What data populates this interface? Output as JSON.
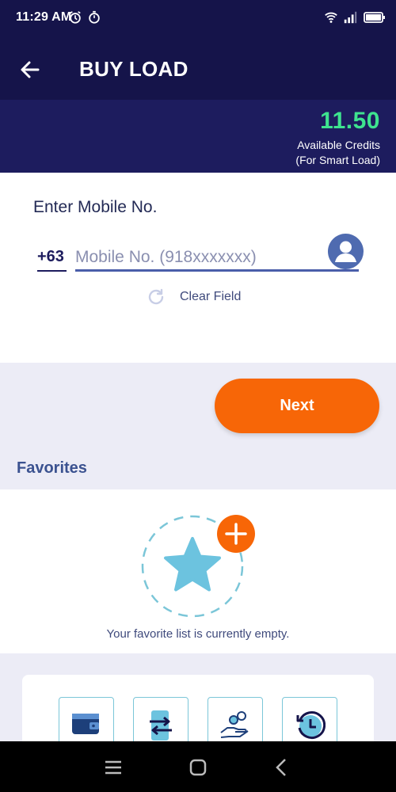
{
  "status_bar": {
    "time": "11:29 AM"
  },
  "header": {
    "title": "BUY LOAD"
  },
  "credits": {
    "amount": "11.50",
    "label": "Available Credits",
    "sublabel": "(For Smart Load)"
  },
  "entry": {
    "label": "Enter Mobile No.",
    "prefix": "+63",
    "placeholder": "Mobile No. (918xxxxxxx)",
    "value": "",
    "clear_label": "Clear Field"
  },
  "next_label": "Next",
  "favorites": {
    "title": "Favorites",
    "empty_message": "Your favorite list is currently empty."
  },
  "services": [
    "wallet-icon",
    "transfer-icon",
    "hand-coin-icon",
    "history-icon"
  ],
  "colors": {
    "header_bg": "#15144a",
    "credits_bg": "#1d1c5e",
    "credits_amount": "#3ee38f",
    "accent": "#f76607",
    "page_bg": "#ececf6"
  }
}
